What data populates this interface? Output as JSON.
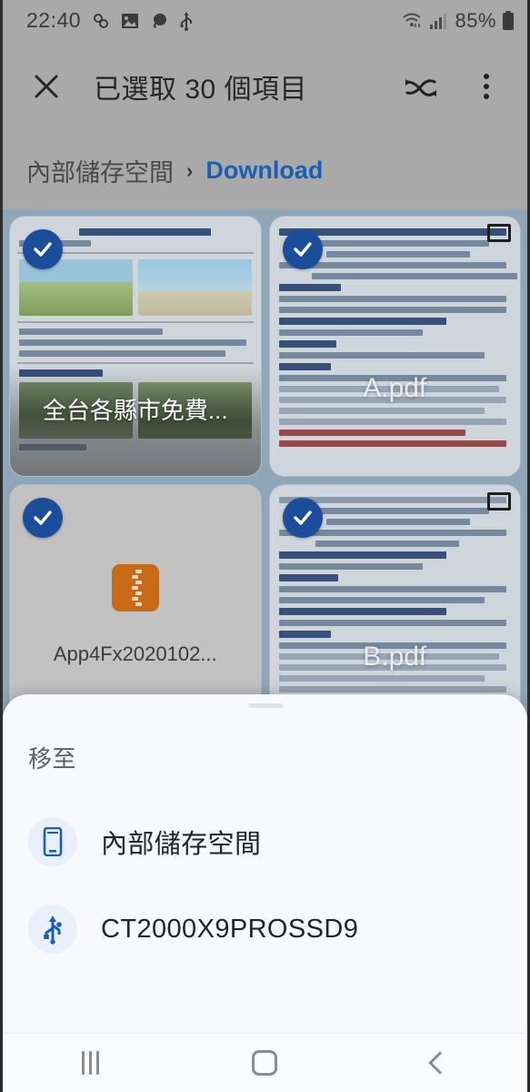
{
  "statusbar": {
    "time": "22:40",
    "battery_percent": "85%",
    "icons": [
      "link-icon",
      "image-icon",
      "chat-bubble-icon",
      "usb-icon",
      "wifi-icon",
      "signal-icon",
      "battery-icon"
    ]
  },
  "toolbar": {
    "close_label": "✕",
    "title": "已選取 30 個項目",
    "shuffle_icon": "shuffle-icon",
    "more_icon": "more-vertical-icon"
  },
  "breadcrumb": {
    "root": "內部儲存空間",
    "separator": "›",
    "current": "Download"
  },
  "files": [
    {
      "name": "全台各縣市免費...",
      "type": "document-preview",
      "selected": true,
      "label_position": "bottom"
    },
    {
      "name": "A.pdf",
      "type": "pdf",
      "selected": true,
      "label_position": "center"
    },
    {
      "name": "App4Fx2020102...",
      "type": "zip",
      "selected": true,
      "label_position": "below-icon"
    },
    {
      "name": "B.pdf",
      "type": "pdf",
      "selected": true,
      "label_position": "center"
    }
  ],
  "sheet": {
    "title": "移至",
    "options": [
      {
        "label": "內部儲存空間",
        "icon": "phone-icon"
      },
      {
        "label": "CT2000X9PROSSD9",
        "icon": "usb-icon"
      }
    ]
  },
  "navbar": {
    "recents": "recents-icon",
    "home": "home-icon",
    "back": "back-icon"
  },
  "colors": {
    "accent_blue": "#1a5fb4",
    "check_blue": "#1b4d9b",
    "grid_bg": "#8fa6b8",
    "bar_bg": "#a9a9a9",
    "sheet_bg": "#f7f9fc",
    "zip_orange": "#c96a17"
  }
}
